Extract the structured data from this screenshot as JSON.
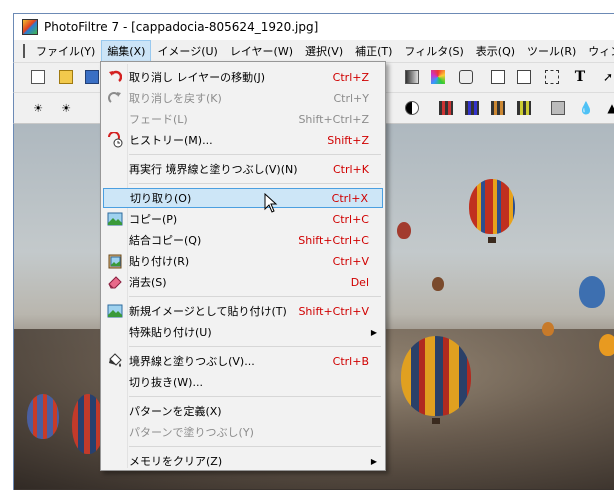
{
  "window": {
    "title": "PhotoFiltre 7 - [cappadocia-805624_1920.jpg]"
  },
  "menubar": {
    "items": [
      "ファイル(Y)",
      "編集(X)",
      "イメージ(U)",
      "レイヤー(W)",
      "選択(V)",
      "補正(T)",
      "フィルタ(S)",
      "表示(Q)",
      "ツール(R)",
      "ウィンドウ"
    ]
  },
  "edit_menu": {
    "items": [
      {
        "label": "取り消し レイヤーの移動(J)",
        "shortcut": "Ctrl+Z",
        "icon": "undo-icon",
        "disabled": false
      },
      {
        "label": "取り消しを戻す(K)",
        "shortcut": "Ctrl+Y",
        "icon": "redo-icon",
        "disabled": true
      },
      {
        "label": "フェード(L)",
        "shortcut": "Shift+Ctrl+Z",
        "icon": "",
        "disabled": true
      },
      {
        "label": "ヒストリー(M)...",
        "shortcut": "Shift+Z",
        "icon": "history-icon",
        "disabled": false
      },
      {
        "label": "再実行 境界線と塗りつぶし(V)(N)",
        "shortcut": "Ctrl+K",
        "icon": "",
        "disabled": false
      },
      {
        "label": "切り取り(O)",
        "shortcut": "Ctrl+X",
        "icon": "",
        "disabled": false,
        "highlighted": true
      },
      {
        "label": "コピー(P)",
        "shortcut": "Ctrl+C",
        "icon": "copy-icon",
        "disabled": false
      },
      {
        "label": "結合コピー(Q)",
        "shortcut": "Shift+Ctrl+C",
        "icon": "",
        "disabled": false
      },
      {
        "label": "貼り付け(R)",
        "shortcut": "Ctrl+V",
        "icon": "paste-icon",
        "disabled": false
      },
      {
        "label": "消去(S)",
        "shortcut": "Del",
        "icon": "eraser-icon",
        "disabled": false
      },
      {
        "label": "新規イメージとして貼り付け(T)",
        "shortcut": "Shift+Ctrl+V",
        "icon": "paste-new-icon",
        "disabled": false
      },
      {
        "label": "特殊貼り付け(U)",
        "shortcut": "",
        "icon": "",
        "disabled": false,
        "submenu": true
      },
      {
        "label": "境界線と塗りつぶし(V)...",
        "shortcut": "Ctrl+B",
        "icon": "fill-icon",
        "disabled": false
      },
      {
        "label": "切り抜き(W)...",
        "shortcut": "",
        "icon": "",
        "disabled": false
      },
      {
        "label": "パターンを定義(X)",
        "shortcut": "",
        "icon": "",
        "disabled": false
      },
      {
        "label": "パターンで塗りつぶし(Y)",
        "shortcut": "",
        "icon": "",
        "disabled": true
      },
      {
        "label": "メモリをクリア(Z)",
        "shortcut": "",
        "icon": "",
        "disabled": false,
        "submenu": true
      }
    ]
  },
  "colors": {
    "highlight": "#cde6f7",
    "shortcut": "#d00000",
    "disabled": "#8c8c8c"
  }
}
